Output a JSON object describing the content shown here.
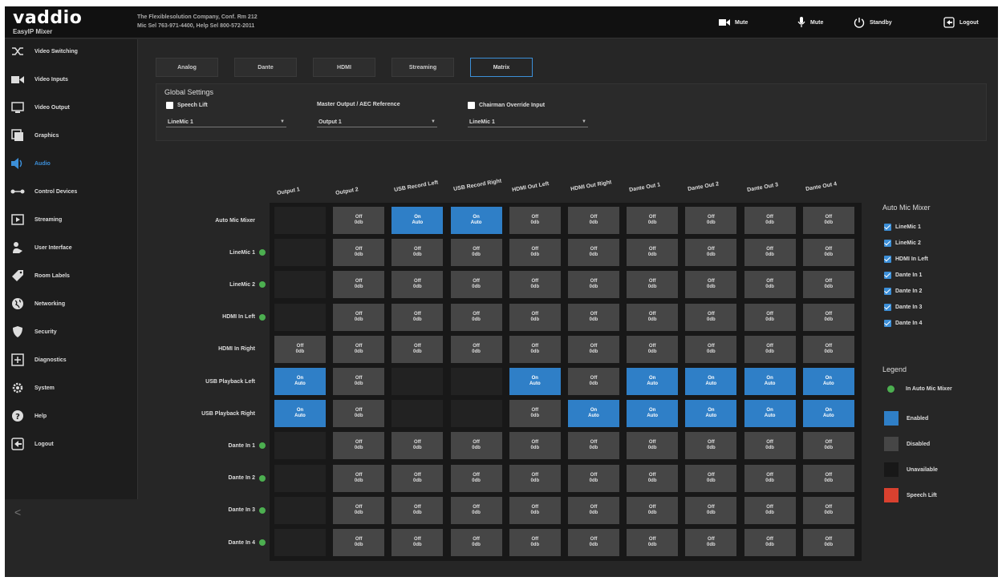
{
  "header": {
    "logo": "vaddio",
    "product": "EasyIP Mixer",
    "company_line1": "The Flexiblesolution Company, Conf. Rm 212",
    "company_line2": "Mic Sel 763-971-4400, Help Sel 800-572-2011",
    "buttons": [
      {
        "label": "Mute",
        "icon": "camera-icon"
      },
      {
        "label": "Mute",
        "icon": "microphone-icon"
      },
      {
        "label": "Standby",
        "icon": "power-icon"
      },
      {
        "label": "Logout",
        "icon": "logout-icon"
      }
    ]
  },
  "sidebar": {
    "items": [
      {
        "label": "Video Switching",
        "icon": "switching-icon"
      },
      {
        "label": "Video Inputs",
        "icon": "camera-icon"
      },
      {
        "label": "Video Output",
        "icon": "monitor-icon"
      },
      {
        "label": "Graphics",
        "icon": "graphics-icon"
      },
      {
        "label": "Audio",
        "icon": "speaker-icon",
        "active": true
      },
      {
        "label": "Control Devices",
        "icon": "control-devices-icon"
      },
      {
        "label": "Streaming",
        "icon": "streaming-icon"
      },
      {
        "label": "User Interface",
        "icon": "user-interface-icon"
      },
      {
        "label": "Room Labels",
        "icon": "tag-icon"
      },
      {
        "label": "Networking",
        "icon": "globe-icon"
      },
      {
        "label": "Security",
        "icon": "shield-icon"
      },
      {
        "label": "Diagnostics",
        "icon": "diagnostics-icon"
      },
      {
        "label": "System",
        "icon": "gear-icon"
      },
      {
        "label": "Help",
        "icon": "help-icon"
      },
      {
        "label": "Logout",
        "icon": "logout-icon"
      }
    ],
    "collapse_glyph": "<"
  },
  "tabs": [
    {
      "label": "Analog"
    },
    {
      "label": "Dante"
    },
    {
      "label": "HDMI"
    },
    {
      "label": "Streaming"
    },
    {
      "label": "Matrix",
      "active": true
    }
  ],
  "global": {
    "title": "Global Settings",
    "speech_lift_label": "Speech Lift",
    "speech_lift_checked": false,
    "speech_lift_select": "LineMic 1",
    "master_output_label": "Master Output / AEC Reference",
    "master_output_select": "Output 1",
    "chairman_label": "Chairman Override Input",
    "chairman_checked": false,
    "chairman_select": "LineMic 1"
  },
  "matrix": {
    "columns": [
      "Output 1",
      "Output 2",
      "USB Record Left",
      "USB Record Right",
      "HDMI Out Left",
      "HDMI Out Right",
      "Dante Out 1",
      "Dante Out 2",
      "Dante Out 3",
      "Dante Out 4"
    ],
    "rows": [
      {
        "label": "Auto Mic Mixer",
        "dot": false,
        "cells": [
          "na",
          "dis",
          "en",
          "en",
          "dis",
          "dis",
          "dis",
          "dis",
          "dis",
          "dis"
        ]
      },
      {
        "label": "LineMic 1",
        "dot": true,
        "cells": [
          "na",
          "dis",
          "dis",
          "dis",
          "dis",
          "dis",
          "dis",
          "dis",
          "dis",
          "dis"
        ]
      },
      {
        "label": "LineMic 2",
        "dot": true,
        "cells": [
          "na",
          "dis",
          "dis",
          "dis",
          "dis",
          "dis",
          "dis",
          "dis",
          "dis",
          "dis"
        ]
      },
      {
        "label": "HDMI In Left",
        "dot": true,
        "cells": [
          "na",
          "dis",
          "dis",
          "dis",
          "dis",
          "dis",
          "dis",
          "dis",
          "dis",
          "dis"
        ]
      },
      {
        "label": "HDMI In Right",
        "dot": false,
        "cells": [
          "dis",
          "dis",
          "dis",
          "dis",
          "dis",
          "dis",
          "dis",
          "dis",
          "dis",
          "dis"
        ]
      },
      {
        "label": "USB Playback Left",
        "dot": false,
        "cells": [
          "en",
          "dis",
          "na",
          "na",
          "en",
          "dis",
          "en",
          "en",
          "en",
          "en"
        ]
      },
      {
        "label": "USB Playback Right",
        "dot": false,
        "cells": [
          "en",
          "dis",
          "na",
          "na",
          "dis",
          "en",
          "en",
          "en",
          "en",
          "en"
        ]
      },
      {
        "label": "Dante In 1",
        "dot": true,
        "cells": [
          "na",
          "dis",
          "dis",
          "dis",
          "dis",
          "dis",
          "dis",
          "dis",
          "dis",
          "dis"
        ]
      },
      {
        "label": "Dante In 2",
        "dot": true,
        "cells": [
          "na",
          "dis",
          "dis",
          "dis",
          "dis",
          "dis",
          "dis",
          "dis",
          "dis",
          "dis"
        ]
      },
      {
        "label": "Dante In 3",
        "dot": true,
        "cells": [
          "na",
          "dis",
          "dis",
          "dis",
          "dis",
          "dis",
          "dis",
          "dis",
          "dis",
          "dis"
        ]
      },
      {
        "label": "Dante In 4",
        "dot": true,
        "cells": [
          "na",
          "dis",
          "dis",
          "dis",
          "dis",
          "dis",
          "dis",
          "dis",
          "dis",
          "dis"
        ]
      }
    ],
    "cell_text": {
      "en": [
        "On",
        "Auto"
      ],
      "dis": [
        "Off",
        "0db"
      ]
    }
  },
  "automix": {
    "title": "Auto Mic Mixer",
    "items": [
      {
        "label": "LineMic 1",
        "checked": true
      },
      {
        "label": "LineMic 2",
        "checked": true
      },
      {
        "label": "HDMI In Left",
        "checked": true
      },
      {
        "label": "Dante In 1",
        "checked": true
      },
      {
        "label": "Dante In 2",
        "checked": true
      },
      {
        "label": "Dante In 3",
        "checked": true
      },
      {
        "label": "Dante In 4",
        "checked": true
      }
    ]
  },
  "legend": {
    "title": "Legend",
    "items": [
      {
        "label": "In Auto Mic Mixer",
        "kind": "dot",
        "color": "#4caf50"
      },
      {
        "label": "Enabled",
        "kind": "swatch",
        "color": "#2f7fc7"
      },
      {
        "label": "Disabled",
        "kind": "swatch",
        "color": "#464646"
      },
      {
        "label": "Unavailable",
        "kind": "swatch",
        "color": "#181818"
      },
      {
        "label": "Speech Lift",
        "kind": "swatch",
        "color": "#d9412f"
      }
    ]
  },
  "colors": {
    "accent": "#3c8fd8",
    "enabled": "#2f7fc7",
    "disabled": "#464646",
    "in_automix": "#4caf50"
  }
}
